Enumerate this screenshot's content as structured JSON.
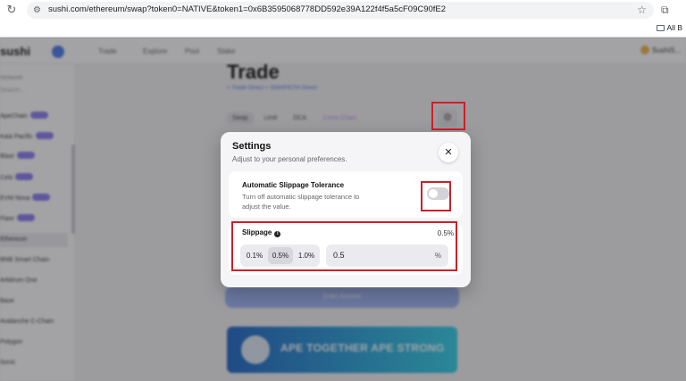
{
  "browser": {
    "url": "sushi.com/ethereum/swap?token0=NATIVE&token1=0x6B3595068778DD592e39A122f4f5a5cF09C90fE2",
    "bookmarks_label": "All B"
  },
  "app": {
    "logo": "sushi",
    "nav": [
      "Trade",
      "Explore",
      "Pool",
      "Stake"
    ],
    "wallet_label": "SushiS...",
    "sidebar": {
      "items": [
        {
          "label": "Network"
        },
        {
          "label": "Search..."
        },
        {
          "label": "ApeChain",
          "badge": true
        },
        {
          "label": "Kaia Pacific",
          "badge": true
        },
        {
          "label": "Blast",
          "badge": true
        },
        {
          "label": "Celo",
          "badge": true
        },
        {
          "label": "EVM Nova",
          "badge": true
        },
        {
          "label": "Flare",
          "badge": true
        },
        {
          "label": "Ethereum",
          "active": true
        },
        {
          "label": "BNB Smart Chain"
        },
        {
          "label": "Arbitrum One"
        },
        {
          "label": "Base"
        },
        {
          "label": "Avalanche C-Chain"
        },
        {
          "label": "Polygon"
        },
        {
          "label": "Sonic"
        }
      ]
    },
    "page_title": "Trade",
    "page_subtitle": "+ Trade Direct + SWAP/ETH Direct",
    "tabs": [
      "Swap",
      "Limit",
      "DCA",
      "Cross Chain"
    ],
    "enter_amount": "Enter Amount",
    "banner_text": "APE TOGETHER APE STRONG"
  },
  "settings": {
    "title": "Settings",
    "subtitle": "Adjust to your personal preferences.",
    "auto_slippage": {
      "title": "Automatic Slippage Tolerance",
      "description": "Turn off automatic slippage tolerance to adjust the value.",
      "enabled": false
    },
    "slippage": {
      "label": "Slippage",
      "current": "0.5%",
      "presets": [
        "0.1%",
        "0.5%",
        "1.0%"
      ],
      "selected_preset": "0.5%",
      "custom_value": "0.5",
      "unit": "%"
    }
  },
  "colors": {
    "highlight": "#d11d2a",
    "accent": "#4a7cf0"
  }
}
